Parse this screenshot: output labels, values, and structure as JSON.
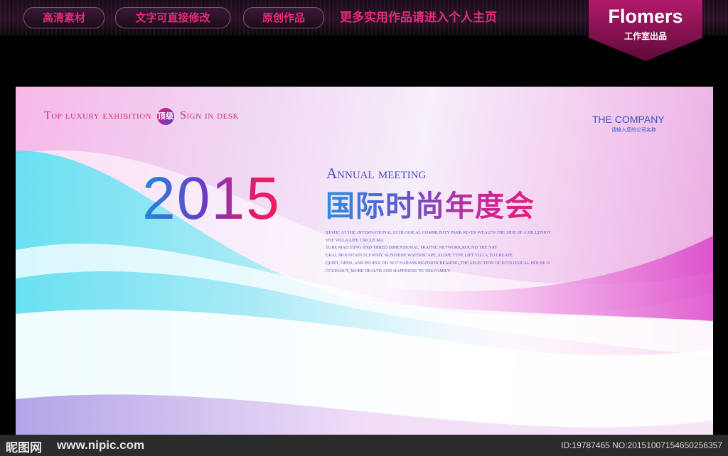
{
  "top_nav": {
    "pills": [
      "高清素材",
      "文字可直接修改",
      "原创作品"
    ],
    "promo": "更多实用作品请进入个人主页"
  },
  "brand": {
    "name": "Flomers",
    "sub": "工作室出品"
  },
  "banner": {
    "tagline_parts": [
      "Top luxury exhibition",
      "顶级",
      "Sign in desk"
    ],
    "company": "THE COMPANY",
    "company_sub": "请输入您的公司名称",
    "year": "2015",
    "annual": "Annual meeting",
    "title_cn": "国际时尚年度会",
    "body_lines": [
      "STATIC AT THE INTERNATIONAL ECOLOGICAL COMMUNITY PARK RIVER WEALTH THE SIDE OF A HILLENIOY",
      "THE VILLA LIFE CIRCLE MA",
      "TURE MATCHING AND THREE-DIMENSIONAL TRAFFIC NETWORK,ROUND THE NAT",
      "URAL MOUNTAIN SCENERY, SUNSHINE WATERSCAPE, SLOPE TYPE LIFT VILLA,TO CREATE",
      "QUIET, OPEN, AND PEOPLE DO NOT HARASS MANSION BEARING,THE SELECTION OF ECOLOGICAL HOUSE O",
      "CCUPANCY, MORE HEALTH AND HAPPINESS TO THE FAMILY."
    ]
  },
  "footer": {
    "logo": "昵图网",
    "site": "www.nipic.com",
    "id_text": "ID:19787465 NO:20151007154650256357"
  }
}
